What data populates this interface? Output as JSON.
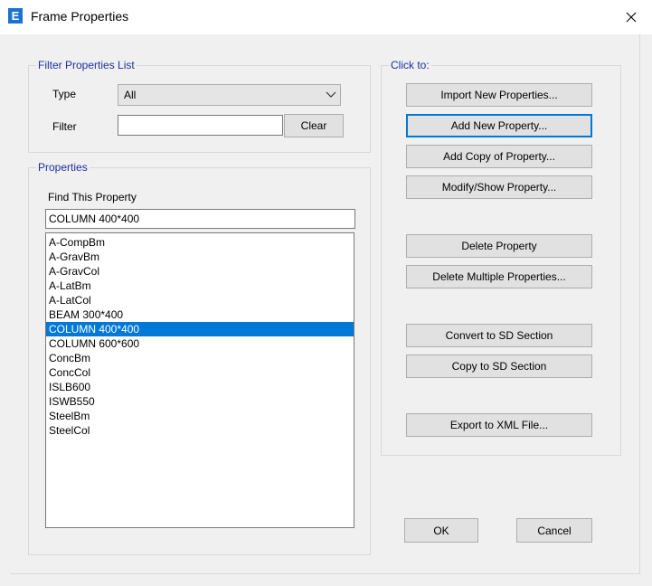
{
  "window": {
    "title": "Frame Properties",
    "app_icon_letter": "E",
    "close_glyph": "✕"
  },
  "filter": {
    "legend": "Filter Properties List",
    "type_label": "Type",
    "type_value": "All",
    "filter_label": "Filter",
    "filter_value": "",
    "clear_button": "Clear"
  },
  "properties": {
    "legend": "Properties",
    "find_label": "Find This Property",
    "find_value": "COLUMN 400*400",
    "items": [
      {
        "label": "A-CompBm",
        "selected": false
      },
      {
        "label": "A-GravBm",
        "selected": false
      },
      {
        "label": "A-GravCol",
        "selected": false
      },
      {
        "label": "A-LatBm",
        "selected": false
      },
      {
        "label": "A-LatCol",
        "selected": false
      },
      {
        "label": "BEAM 300*400",
        "selected": false
      },
      {
        "label": "COLUMN 400*400",
        "selected": true
      },
      {
        "label": "COLUMN 600*600",
        "selected": false
      },
      {
        "label": "ConcBm",
        "selected": false
      },
      {
        "label": "ConcCol",
        "selected": false
      },
      {
        "label": "ISLB600",
        "selected": false
      },
      {
        "label": "ISWB550",
        "selected": false
      },
      {
        "label": "SteelBm",
        "selected": false
      },
      {
        "label": "SteelCol",
        "selected": false
      }
    ]
  },
  "click_to": {
    "legend": "Click to:",
    "import_new": "Import New Properties...",
    "add_new": "Add New Property...",
    "add_copy": "Add Copy of Property...",
    "modify_show": "Modify/Show Property...",
    "delete": "Delete Property",
    "delete_multiple": "Delete Multiple Properties...",
    "convert_sd": "Convert to SD Section",
    "copy_sd": "Copy to SD Section",
    "export_xml": "Export to XML File..."
  },
  "footer": {
    "ok": "OK",
    "cancel": "Cancel"
  },
  "colors": {
    "accent": "#0078d7",
    "legend_text": "#1d2fa0",
    "app_icon": "#1a73d0"
  }
}
